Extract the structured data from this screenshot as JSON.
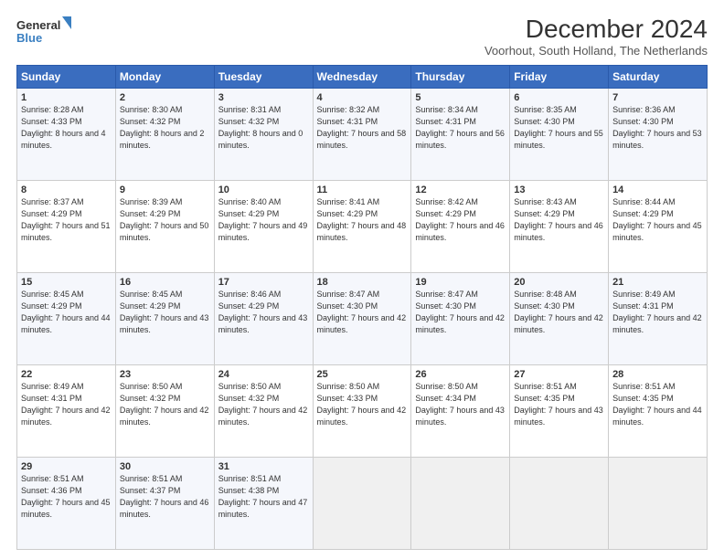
{
  "logo": {
    "line1": "General",
    "line2": "Blue"
  },
  "title": "December 2024",
  "subtitle": "Voorhout, South Holland, The Netherlands",
  "header": {
    "days": [
      "Sunday",
      "Monday",
      "Tuesday",
      "Wednesday",
      "Thursday",
      "Friday",
      "Saturday"
    ]
  },
  "weeks": [
    [
      {
        "day": "1",
        "sunrise": "8:28 AM",
        "sunset": "4:33 PM",
        "daylight": "8 hours and 4 minutes."
      },
      {
        "day": "2",
        "sunrise": "8:30 AM",
        "sunset": "4:32 PM",
        "daylight": "8 hours and 2 minutes."
      },
      {
        "day": "3",
        "sunrise": "8:31 AM",
        "sunset": "4:32 PM",
        "daylight": "8 hours and 0 minutes."
      },
      {
        "day": "4",
        "sunrise": "8:32 AM",
        "sunset": "4:31 PM",
        "daylight": "7 hours and 58 minutes."
      },
      {
        "day": "5",
        "sunrise": "8:34 AM",
        "sunset": "4:31 PM",
        "daylight": "7 hours and 56 minutes."
      },
      {
        "day": "6",
        "sunrise": "8:35 AM",
        "sunset": "4:30 PM",
        "daylight": "7 hours and 55 minutes."
      },
      {
        "day": "7",
        "sunrise": "8:36 AM",
        "sunset": "4:30 PM",
        "daylight": "7 hours and 53 minutes."
      }
    ],
    [
      {
        "day": "8",
        "sunrise": "8:37 AM",
        "sunset": "4:29 PM",
        "daylight": "7 hours and 51 minutes."
      },
      {
        "day": "9",
        "sunrise": "8:39 AM",
        "sunset": "4:29 PM",
        "daylight": "7 hours and 50 minutes."
      },
      {
        "day": "10",
        "sunrise": "8:40 AM",
        "sunset": "4:29 PM",
        "daylight": "7 hours and 49 minutes."
      },
      {
        "day": "11",
        "sunrise": "8:41 AM",
        "sunset": "4:29 PM",
        "daylight": "7 hours and 48 minutes."
      },
      {
        "day": "12",
        "sunrise": "8:42 AM",
        "sunset": "4:29 PM",
        "daylight": "7 hours and 46 minutes."
      },
      {
        "day": "13",
        "sunrise": "8:43 AM",
        "sunset": "4:29 PM",
        "daylight": "7 hours and 46 minutes."
      },
      {
        "day": "14",
        "sunrise": "8:44 AM",
        "sunset": "4:29 PM",
        "daylight": "7 hours and 45 minutes."
      }
    ],
    [
      {
        "day": "15",
        "sunrise": "8:45 AM",
        "sunset": "4:29 PM",
        "daylight": "7 hours and 44 minutes."
      },
      {
        "day": "16",
        "sunrise": "8:45 AM",
        "sunset": "4:29 PM",
        "daylight": "7 hours and 43 minutes."
      },
      {
        "day": "17",
        "sunrise": "8:46 AM",
        "sunset": "4:29 PM",
        "daylight": "7 hours and 43 minutes."
      },
      {
        "day": "18",
        "sunrise": "8:47 AM",
        "sunset": "4:30 PM",
        "daylight": "7 hours and 42 minutes."
      },
      {
        "day": "19",
        "sunrise": "8:47 AM",
        "sunset": "4:30 PM",
        "daylight": "7 hours and 42 minutes."
      },
      {
        "day": "20",
        "sunrise": "8:48 AM",
        "sunset": "4:30 PM",
        "daylight": "7 hours and 42 minutes."
      },
      {
        "day": "21",
        "sunrise": "8:49 AM",
        "sunset": "4:31 PM",
        "daylight": "7 hours and 42 minutes."
      }
    ],
    [
      {
        "day": "22",
        "sunrise": "8:49 AM",
        "sunset": "4:31 PM",
        "daylight": "7 hours and 42 minutes."
      },
      {
        "day": "23",
        "sunrise": "8:50 AM",
        "sunset": "4:32 PM",
        "daylight": "7 hours and 42 minutes."
      },
      {
        "day": "24",
        "sunrise": "8:50 AM",
        "sunset": "4:32 PM",
        "daylight": "7 hours and 42 minutes."
      },
      {
        "day": "25",
        "sunrise": "8:50 AM",
        "sunset": "4:33 PM",
        "daylight": "7 hours and 42 minutes."
      },
      {
        "day": "26",
        "sunrise": "8:50 AM",
        "sunset": "4:34 PM",
        "daylight": "7 hours and 43 minutes."
      },
      {
        "day": "27",
        "sunrise": "8:51 AM",
        "sunset": "4:35 PM",
        "daylight": "7 hours and 43 minutes."
      },
      {
        "day": "28",
        "sunrise": "8:51 AM",
        "sunset": "4:35 PM",
        "daylight": "7 hours and 44 minutes."
      }
    ],
    [
      {
        "day": "29",
        "sunrise": "8:51 AM",
        "sunset": "4:36 PM",
        "daylight": "7 hours and 45 minutes."
      },
      {
        "day": "30",
        "sunrise": "8:51 AM",
        "sunset": "4:37 PM",
        "daylight": "7 hours and 46 minutes."
      },
      {
        "day": "31",
        "sunrise": "8:51 AM",
        "sunset": "4:38 PM",
        "daylight": "7 hours and 47 minutes."
      },
      null,
      null,
      null,
      null
    ]
  ],
  "labels": {
    "sunrise": "Sunrise:",
    "sunset": "Sunset:",
    "daylight": "Daylight:"
  }
}
